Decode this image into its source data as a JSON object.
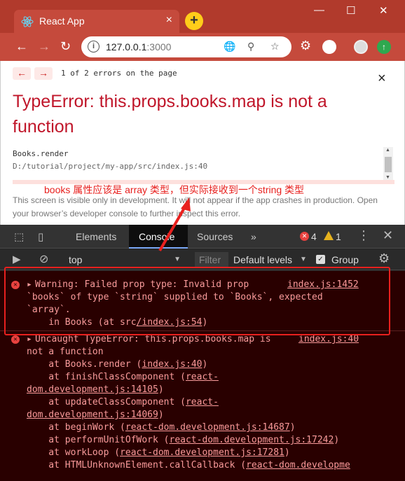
{
  "browser": {
    "tab_title": "React App",
    "tab_close": "×",
    "new_tab": "+",
    "window_controls": [
      "—",
      "☐",
      "✕"
    ],
    "url_host": "127.0.0.1",
    "url_port": ":3000"
  },
  "overlay": {
    "prev": "←",
    "next": "→",
    "count": "1 of 2 errors on the page",
    "close": "×",
    "title": "TypeError: this.props.books.map is not a function",
    "stack_fn": "Books.render",
    "stack_path": "D:/tutorial/project/my-app/src/index.js:40",
    "annotation": "books 属性应该是 array 类型，但实际接收到一个string 类型",
    "dev_note": "This screen is visible only in development. It will not appear if the app crashes in production. Open your browser’s developer console to further inspect this error."
  },
  "devtools": {
    "tabs": [
      "Elements",
      "Console",
      "Sources"
    ],
    "more": "»",
    "error_count": "4",
    "warning_count": "1",
    "context": "top",
    "filter_placeholder": "Filter",
    "levels": "Default levels",
    "group": "Group"
  },
  "console": {
    "warning": {
      "line1": "Warning: Failed prop type: Invalid prop",
      "line2": "`books` of type `string` supplied to `Books`, expected",
      "line3": "`array`.",
      "line4_prefix": "    in Books (at src",
      "line4_link": "/index.js:54",
      "line4_suffix": ")",
      "source": "index.js:1452"
    },
    "error": {
      "line1": "Uncaught TypeError: this.props.books.map is",
      "line2": "not a function",
      "source": "index.js:40",
      "frames": [
        {
          "prefix": "    at Books.render (",
          "link": "index.js:40",
          "suffix": ")"
        },
        {
          "prefix": "    at finishClassComponent (",
          "link": "react-",
          "suffix": ""
        },
        {
          "prefix": "",
          "link": "dom.development.js:14105",
          "suffix": ")"
        },
        {
          "prefix": "    at updateClassComponent (",
          "link": "react-",
          "suffix": ""
        },
        {
          "prefix": "",
          "link": "dom.development.js:14069",
          "suffix": ")"
        },
        {
          "prefix": "    at beginWork (",
          "link": "react-dom.development.js:14687",
          "suffix": ")"
        },
        {
          "prefix": "    at performUnitOfWork (",
          "link": "react-dom.development.js:17242",
          "suffix": ")"
        },
        {
          "prefix": "    at workLoop (",
          "link": "react-dom.development.js:17281",
          "suffix": ")"
        },
        {
          "prefix": "    at HTMLUnknownElement.callCallback (",
          "link": "react-dom.developme",
          "suffix": ""
        }
      ]
    }
  },
  "colors": {
    "chrome_frame": "#b13a2c",
    "error_title": "#c0162a",
    "annotation": "#e8201e",
    "console_bg": "#290000"
  }
}
